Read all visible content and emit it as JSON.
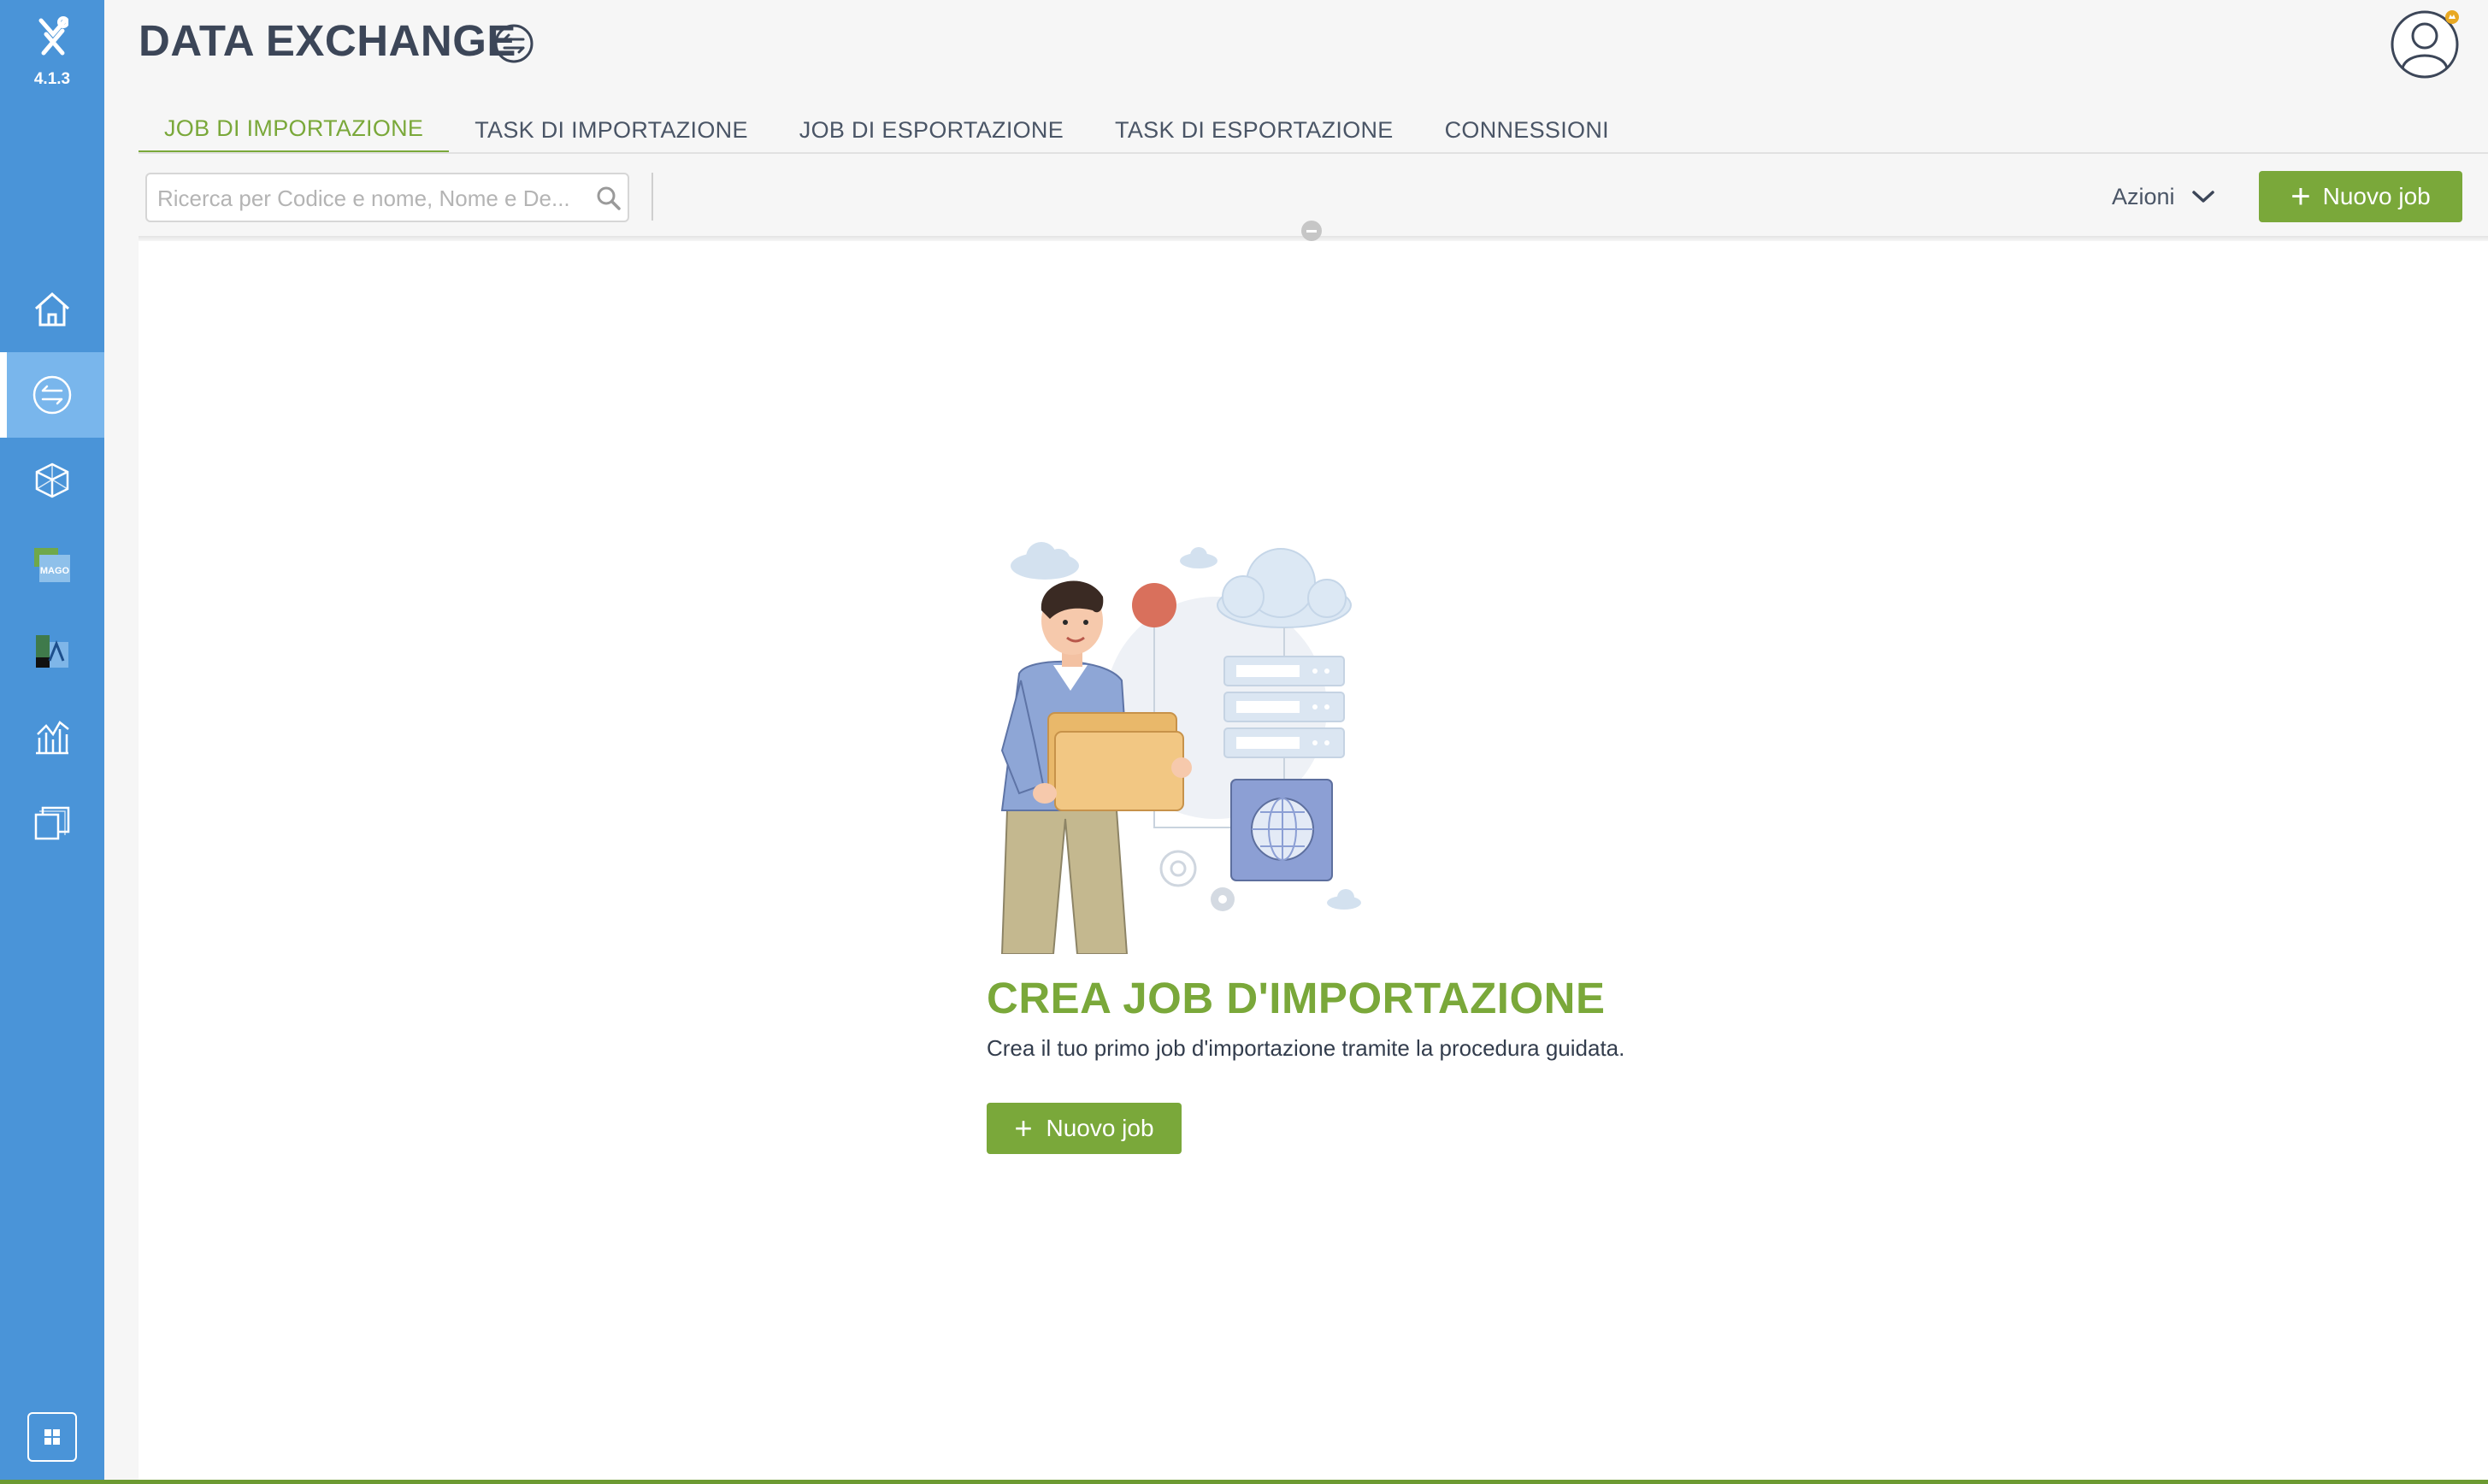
{
  "app": {
    "version": "4.1.3",
    "title": "DATA EXCHANGE"
  },
  "sidebar": {
    "items": [
      {
        "name": "home",
        "icon": "home-icon"
      },
      {
        "name": "data-exchange",
        "icon": "exchange-icon",
        "active": true
      },
      {
        "name": "modeler",
        "icon": "cube-icon"
      },
      {
        "name": "mago",
        "icon": "mago-icon"
      },
      {
        "name": "analytics-app",
        "icon": "app-tiles-icon"
      },
      {
        "name": "reports",
        "icon": "chart-icon"
      },
      {
        "name": "windows",
        "icon": "copy-windows-icon"
      }
    ]
  },
  "tabs": [
    {
      "label": "JOB DI IMPORTAZIONE",
      "active": true
    },
    {
      "label": "TASK DI IMPORTAZIONE"
    },
    {
      "label": "JOB DI ESPORTAZIONE"
    },
    {
      "label": "TASK DI ESPORTAZIONE"
    },
    {
      "label": "CONNESSIONI"
    }
  ],
  "toolbar": {
    "search_placeholder": "Ricerca per Codice e nome, Nome e De...",
    "actions_label": "Azioni",
    "new_job_label": "Nuovo job"
  },
  "empty_state": {
    "title": "CREA JOB D'IMPORTAZIONE",
    "description": "Crea il tuo primo job d'importazione tramite la procedura guidata.",
    "button_label": "Nuovo job"
  },
  "colors": {
    "sidebar": "#4a94d8",
    "accent_green": "#7aa83a",
    "text_dark": "#3c4658"
  }
}
